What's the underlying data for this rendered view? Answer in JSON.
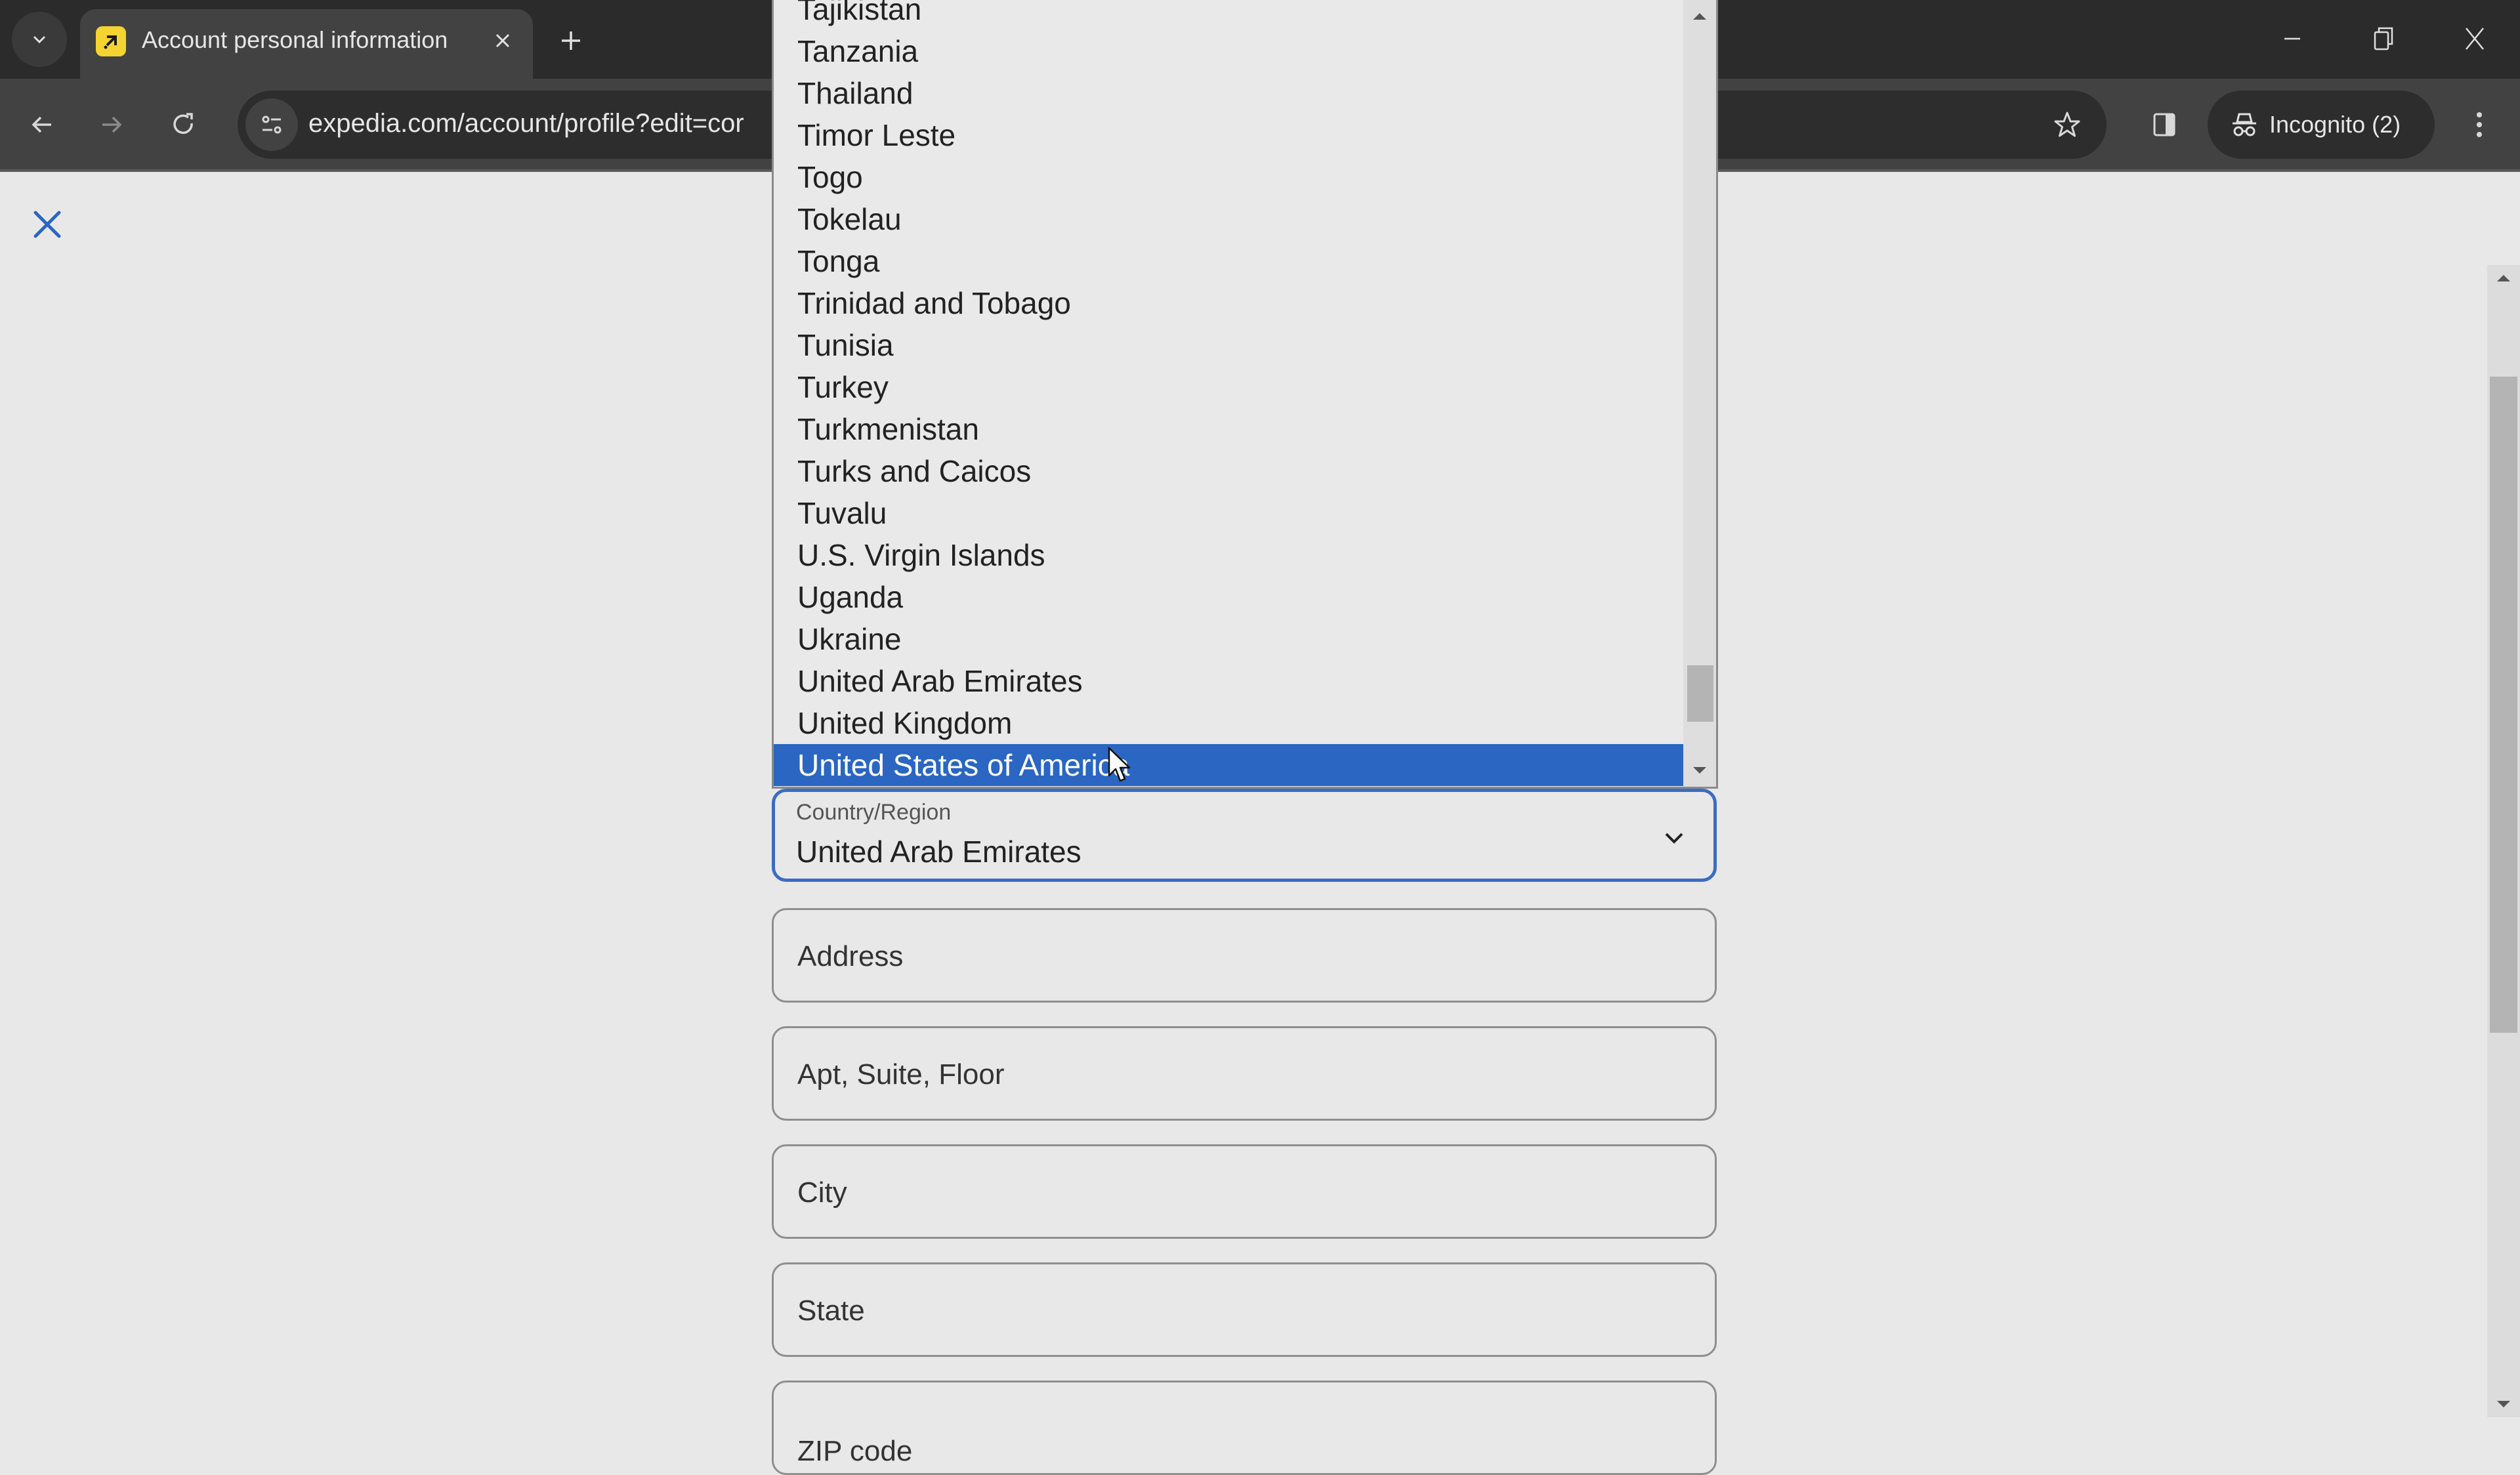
{
  "browser": {
    "tab": {
      "title": "Account personal information"
    },
    "url": "expedia.com/account/profile?edit=cor",
    "incognito_label": "Incognito (2)",
    "colors": {
      "favicon": "#f5d331",
      "accent": "#3b6cc4",
      "selected": "#2a66c2"
    }
  },
  "dropdown": {
    "options": [
      "Tajikistan",
      "Tanzania",
      "Thailand",
      "Timor Leste",
      "Togo",
      "Tokelau",
      "Tonga",
      "Trinidad and Tobago",
      "Tunisia",
      "Turkey",
      "Turkmenistan",
      "Turks and Caicos",
      "Tuvalu",
      "U.S. Virgin Islands",
      "Uganda",
      "Ukraine",
      "United Arab Emirates",
      "United Kingdom",
      "United States of America"
    ],
    "highlighted": "United States of America"
  },
  "form": {
    "country": {
      "label": "Country/Region",
      "value": "United Arab Emirates"
    },
    "address": {
      "placeholder": "Address"
    },
    "apt": {
      "placeholder": "Apt, Suite, Floor"
    },
    "city": {
      "placeholder": "City"
    },
    "state": {
      "placeholder": "State"
    },
    "zip": {
      "placeholder": "ZIP code"
    }
  }
}
